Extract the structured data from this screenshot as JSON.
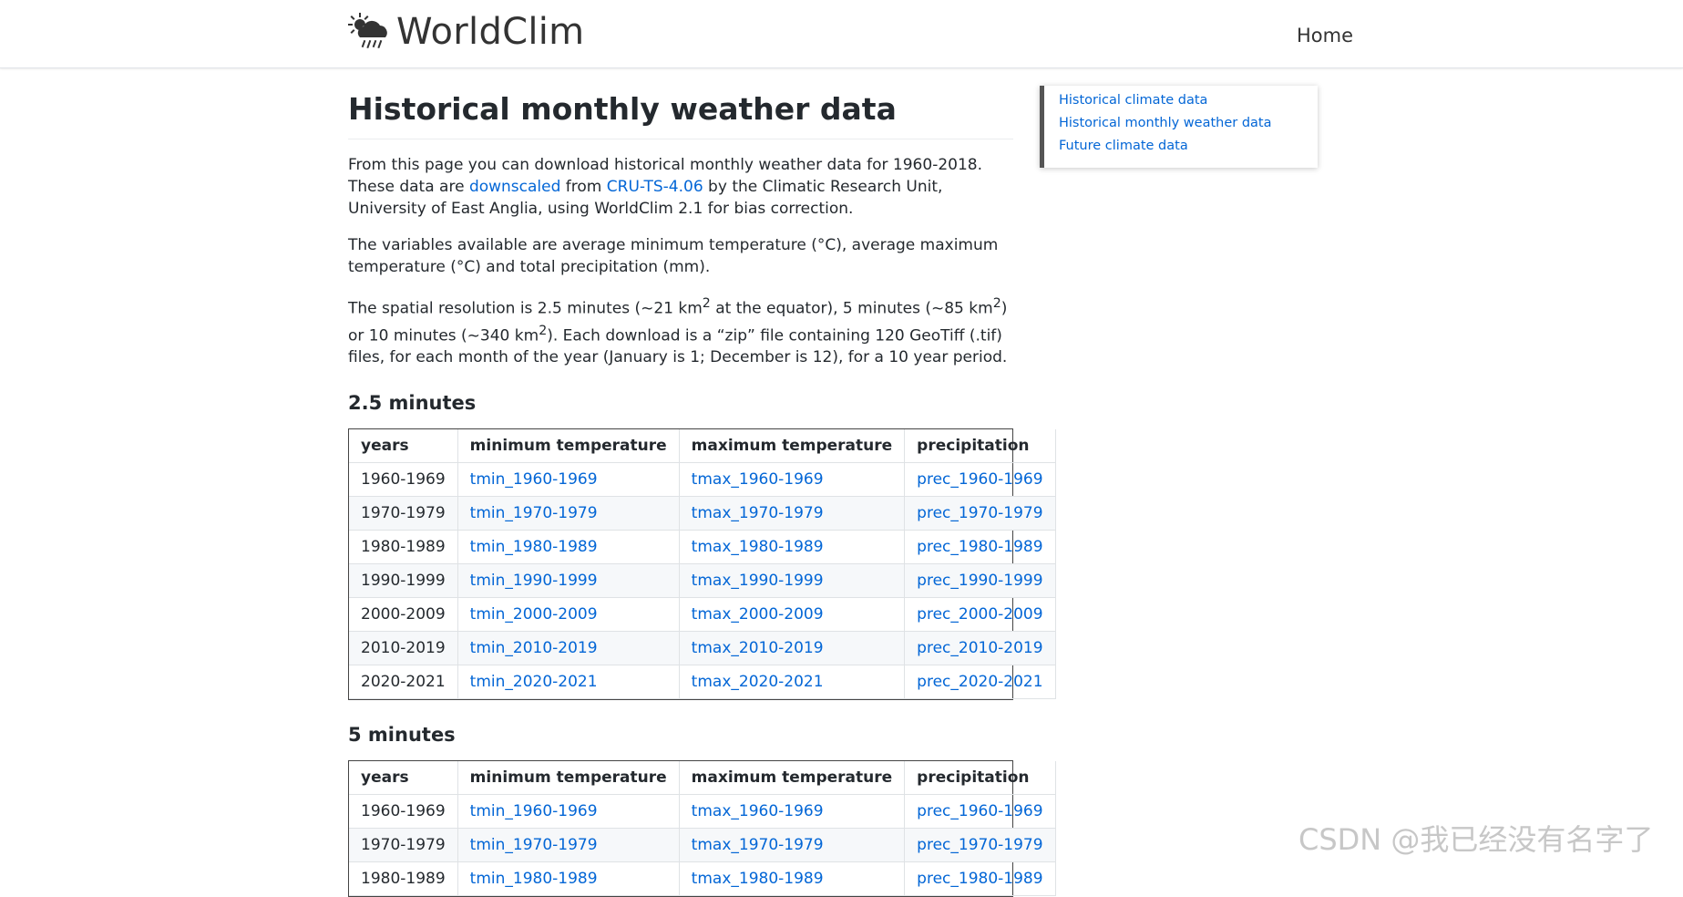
{
  "nav": {
    "brand": "WorldClim",
    "home": "Home"
  },
  "page": {
    "title": "Historical monthly weather data",
    "intro": {
      "part1": "From this page you can download historical monthly weather data for 1960-2018. These data are ",
      "link1": "downscaled",
      "part2": " from ",
      "link2": "CRU-TS-4.06",
      "part3": " by the Climatic Research Unit, University of East Anglia, using WorldClim 2.1 for bias correction."
    },
    "variables": "The variables available are average minimum temperature (°C), average maximum temperature (°C) and total precipitation (mm).",
    "resolution": {
      "part1": "The spatial resolution is 2.5 minutes (~21 km",
      "part2": " at the equator), 5 minutes (~85 km",
      "part3": ") or 10 minutes (~340 km",
      "part4": "). Each download is a “zip” file containing 120 GeoTiff (.tif) files, for each month of the year (January is 1; December is 12), for a 10 year period.",
      "sup": "2"
    }
  },
  "table_headers": {
    "years": "years",
    "tmin": "minimum temperature",
    "tmax": "maximum temperature",
    "prec": "precipitation"
  },
  "section_25": {
    "heading": "2.5 minutes",
    "rows": [
      {
        "years": "1960-1969",
        "tmin": "tmin_1960-1969",
        "tmax": "tmax_1960-1969",
        "prec": "prec_1960-1969"
      },
      {
        "years": "1970-1979",
        "tmin": "tmin_1970-1979",
        "tmax": "tmax_1970-1979",
        "prec": "prec_1970-1979"
      },
      {
        "years": "1980-1989",
        "tmin": "tmin_1980-1989",
        "tmax": "tmax_1980-1989",
        "prec": "prec_1980-1989"
      },
      {
        "years": "1990-1999",
        "tmin": "tmin_1990-1999",
        "tmax": "tmax_1990-1999",
        "prec": "prec_1990-1999"
      },
      {
        "years": "2000-2009",
        "tmin": "tmin_2000-2009",
        "tmax": "tmax_2000-2009",
        "prec": "prec_2000-2009"
      },
      {
        "years": "2010-2019",
        "tmin": "tmin_2010-2019",
        "tmax": "tmax_2010-2019",
        "prec": "prec_2010-2019"
      },
      {
        "years": "2020-2021",
        "tmin": "tmin_2020-2021",
        "tmax": "tmax_2020-2021",
        "prec": "prec_2020-2021"
      }
    ]
  },
  "section_5": {
    "heading": "5 minutes",
    "rows": [
      {
        "years": "1960-1969",
        "tmin": "tmin_1960-1969",
        "tmax": "tmax_1960-1969",
        "prec": "prec_1960-1969"
      },
      {
        "years": "1970-1979",
        "tmin": "tmin_1970-1979",
        "tmax": "tmax_1970-1979",
        "prec": "prec_1970-1979"
      },
      {
        "years": "1980-1989",
        "tmin": "tmin_1980-1989",
        "tmax": "tmax_1980-1989",
        "prec": "prec_1980-1989"
      }
    ]
  },
  "toc": {
    "items": [
      "Historical climate data",
      "Historical monthly weather data",
      "Future climate data"
    ]
  },
  "watermark": "CSDN @我已经没有名字了",
  "colors": {
    "link": "#0366d6",
    "text": "#24292e",
    "toc_border": "#555555"
  },
  "icons": {
    "brand": "cloud-sun-rain-icon"
  }
}
